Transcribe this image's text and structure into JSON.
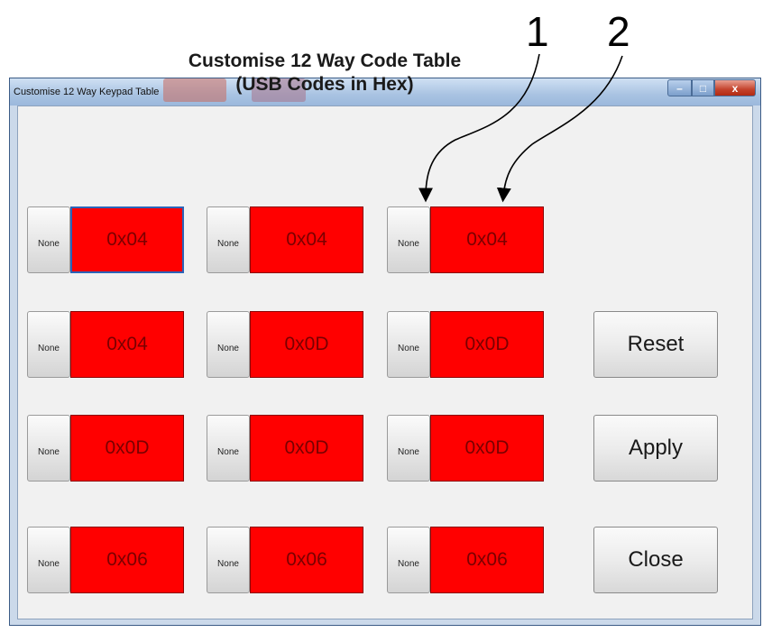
{
  "annotations": {
    "callout_1": "1",
    "callout_2": "2"
  },
  "window": {
    "title": "Customise 12 Way Keypad Table",
    "heading_line1": "Customise 12 Way Code Table",
    "heading_line2": "(USB Codes in Hex)",
    "controls": {
      "minimize": "–",
      "maximize": "□",
      "close": "x"
    }
  },
  "keys": [
    {
      "modifier": "None",
      "code": "0x04"
    },
    {
      "modifier": "None",
      "code": "0x04"
    },
    {
      "modifier": "None",
      "code": "0x04"
    },
    {
      "modifier": "None",
      "code": "0x04"
    },
    {
      "modifier": "None",
      "code": "0x0D"
    },
    {
      "modifier": "None",
      "code": "0x0D"
    },
    {
      "modifier": "None",
      "code": "0x0D"
    },
    {
      "modifier": "None",
      "code": "0x0D"
    },
    {
      "modifier": "None",
      "code": "0x0D"
    },
    {
      "modifier": "None",
      "code": "0x06"
    },
    {
      "modifier": "None",
      "code": "0x06"
    },
    {
      "modifier": "None",
      "code": "0x06"
    }
  ],
  "actions": {
    "reset": "Reset",
    "apply": "Apply",
    "close": "Close"
  },
  "colors": {
    "code_field": "#ff0000",
    "code_text": "#7a0000"
  }
}
